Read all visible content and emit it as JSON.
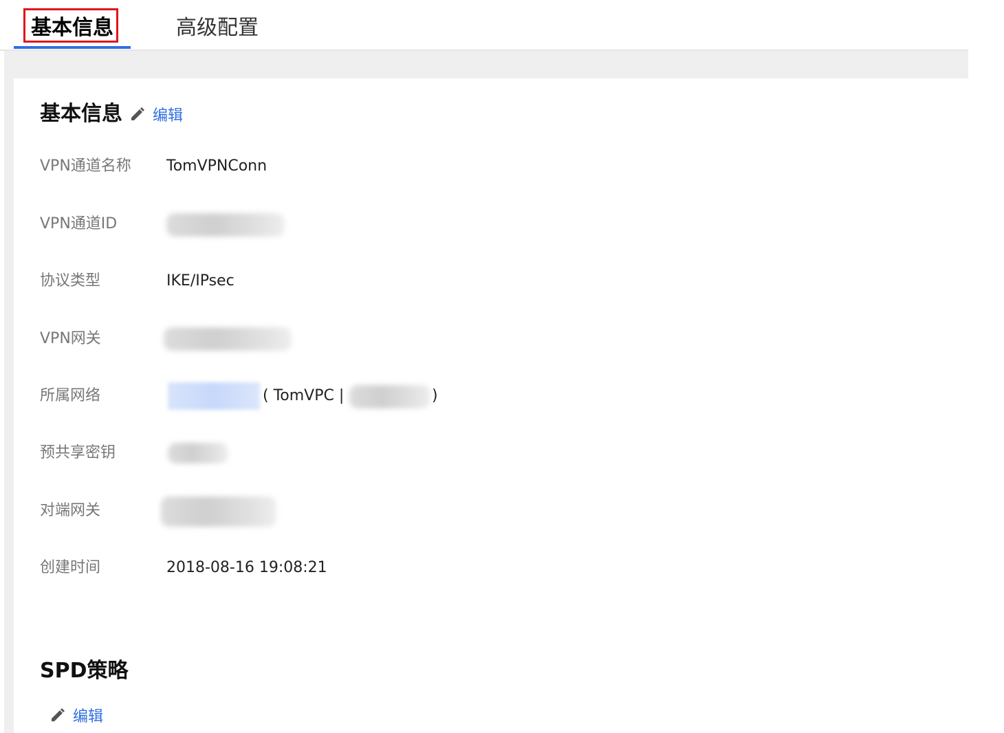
{
  "tabs": {
    "basic_label": "基本信息",
    "advanced_label": "高级配置"
  },
  "basic_section": {
    "title": "基本信息",
    "edit_label": "编辑"
  },
  "fields": {
    "name_label": "VPN通道名称",
    "name_value": "TomVPNConn",
    "id_label": "VPN通道ID",
    "protocol_label": "协议类型",
    "protocol_value": "IKE/IPsec",
    "gateway_label": "VPN网关",
    "network_label": "所属网络",
    "network_vpc_prefix": "( TomVPC |",
    "network_vpc_suffix": ")",
    "psk_label": "预共享密钥",
    "peer_gateway_label": "对端网关",
    "created_label": "创建时间",
    "created_value": "2018-08-16 19:08:21"
  },
  "spd_section": {
    "title": "SPD策略",
    "edit_label": "编辑"
  },
  "colors": {
    "accent": "#2f6fe4",
    "highlight_border": "#e0151b",
    "label": "#777777",
    "band": "#efefef"
  }
}
